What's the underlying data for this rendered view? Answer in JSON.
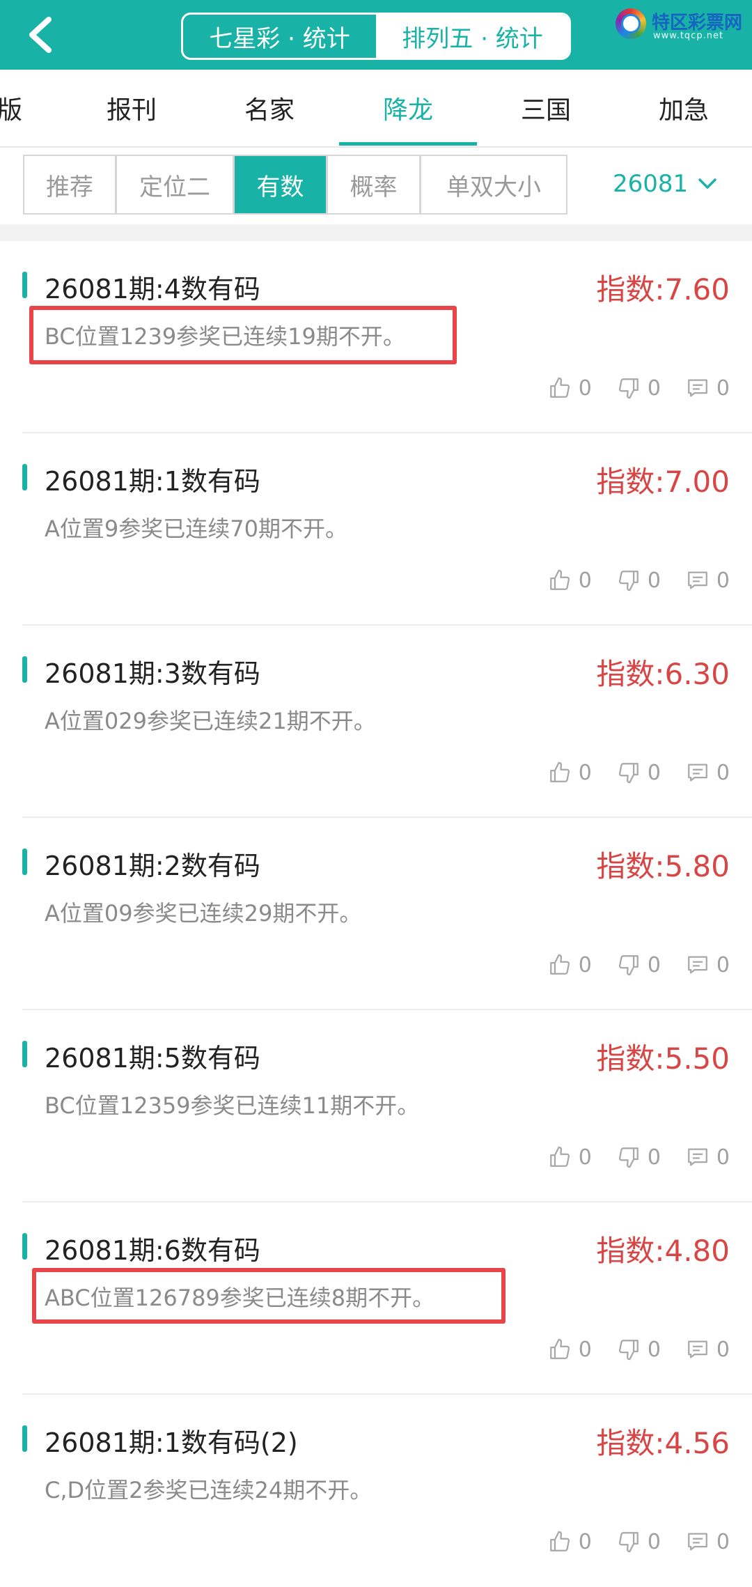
{
  "header": {
    "segments": [
      {
        "label": "七星彩 · 统计",
        "active": false
      },
      {
        "label": "排列五 · 统计",
        "active": true
      }
    ],
    "logo": {
      "title": "特区彩票网",
      "sub": "www.tqcp.net"
    }
  },
  "tabs": [
    {
      "label": "版"
    },
    {
      "label": "报刊"
    },
    {
      "label": "名家"
    },
    {
      "label": "降龙",
      "active": true
    },
    {
      "label": "三国"
    },
    {
      "label": "加急"
    }
  ],
  "subtabs": [
    {
      "label": "推荐"
    },
    {
      "label": "定位二"
    },
    {
      "label": "有数",
      "active": true
    },
    {
      "label": "概率"
    },
    {
      "label": "单双大小"
    }
  ],
  "period": "26081",
  "items": [
    {
      "title": "26081期:4数有码",
      "index": "指数:7.60",
      "desc": "BC位置1239参奖已连续19期不开。",
      "likes": "0",
      "dislikes": "0",
      "comments": "0",
      "highlighted": true
    },
    {
      "title": "26081期:1数有码",
      "index": "指数:7.00",
      "desc": "A位置9参奖已连续70期不开。",
      "likes": "0",
      "dislikes": "0",
      "comments": "0"
    },
    {
      "title": "26081期:3数有码",
      "index": "指数:6.30",
      "desc": "A位置029参奖已连续21期不开。",
      "likes": "0",
      "dislikes": "0",
      "comments": "0"
    },
    {
      "title": "26081期:2数有码",
      "index": "指数:5.80",
      "desc": "A位置09参奖已连续29期不开。",
      "likes": "0",
      "dislikes": "0",
      "comments": "0"
    },
    {
      "title": "26081期:5数有码",
      "index": "指数:5.50",
      "desc": "BC位置12359参奖已连续11期不开。",
      "likes": "0",
      "dislikes": "0",
      "comments": "0"
    },
    {
      "title": "26081期:6数有码",
      "index": "指数:4.80",
      "desc": "ABC位置126789参奖已连续8期不开。",
      "likes": "0",
      "dislikes": "0",
      "comments": "0",
      "highlighted": true
    },
    {
      "title": "26081期:1数有码(2)",
      "index": "指数:4.56",
      "desc": "C,D位置2参奖已连续24期不开。",
      "likes": "0",
      "dislikes": "0",
      "comments": "0"
    }
  ]
}
